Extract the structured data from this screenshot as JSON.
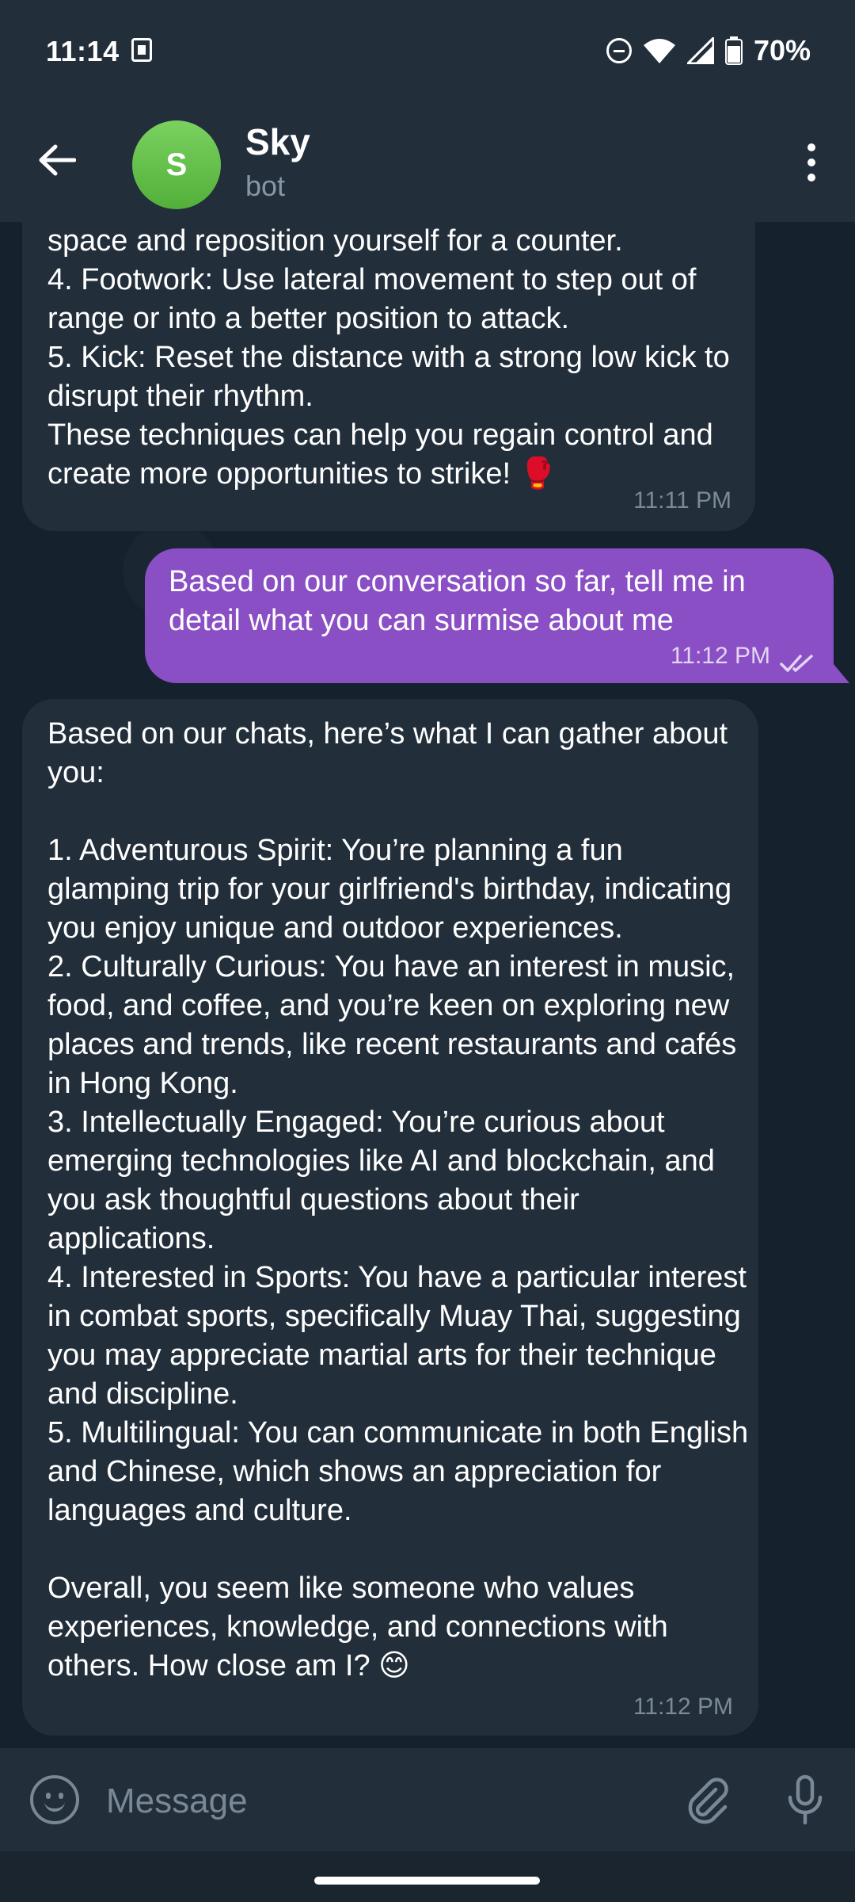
{
  "status_bar": {
    "time": "11:14",
    "battery": "70%"
  },
  "header": {
    "avatar_initial": "S",
    "title": "Sky",
    "subtitle": "bot"
  },
  "messages": [
    {
      "direction": "incoming",
      "text": "space and reposition yourself for a counter.\n4. Footwork: Use lateral movement to step out of range or into a better position to attack.\n5. Kick: Reset the distance with a strong low kick to disrupt their rhythm.\nThese techniques can help you regain control and create more opportunities to strike! 🥊",
      "time": "11:11 PM"
    },
    {
      "direction": "outgoing",
      "text": "Based on our conversation so far, tell me in detail what you can surmise about me",
      "time": "11:12 PM",
      "status": "read"
    },
    {
      "direction": "incoming",
      "text": "Based on our chats, here’s what I can gather about you:\n\n1. Adventurous Spirit: You’re planning a fun glamping trip for your girlfriend's birthday, indicating you enjoy unique and outdoor experiences.\n2. Culturally Curious: You have an interest in music, food, and coffee, and you’re keen on exploring new places and trends, like recent restaurants and cafés in Hong Kong.\n3. Intellectually Engaged: You’re curious about emerging technologies like AI and blockchain, and you ask thoughtful questions about their applications.\n4. Interested in Sports: You have a particular interest in combat sports, specifically Muay Thai, suggesting you may appreciate martial arts for their technique and discipline.\n5. Multilingual: You can communicate in both English and Chinese, which shows an appreciation for languages and culture.\n\nOverall, you seem like someone who values experiences, knowledge, and connections with others. How close am I? 😊",
      "time": "11:12 PM"
    }
  ],
  "input": {
    "placeholder": "Message"
  },
  "colors": {
    "header_bg": "#232e3b",
    "incoming_bubble": "#222e3a",
    "outgoing_bubble": "#8a4fc4",
    "avatar": "#5fbf45"
  }
}
